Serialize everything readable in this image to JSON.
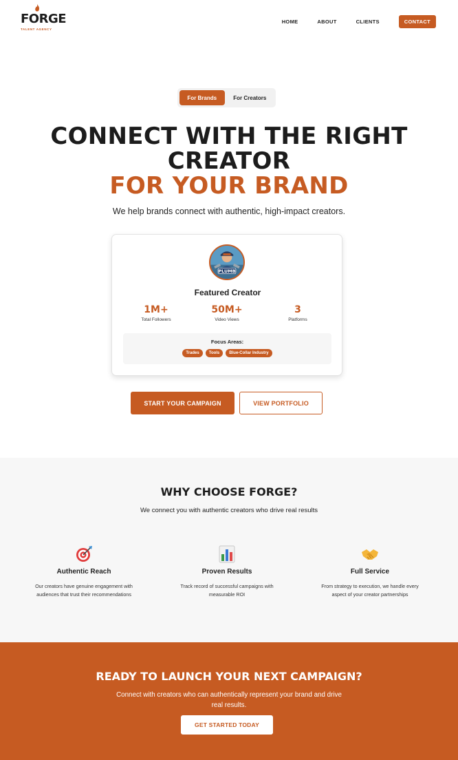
{
  "brand": {
    "name": "FORGE",
    "tagline": "TALENT AGENCY",
    "accent_color": "#c65b22"
  },
  "nav": {
    "items": [
      "HOME",
      "ABOUT",
      "CLIENTS"
    ],
    "contact_label": "CONTACT"
  },
  "toggle": {
    "active_label": "For Brands",
    "inactive_label": "For Creators"
  },
  "hero": {
    "line1": "CONNECT WITH THE RIGHT",
    "line2": "CREATOR",
    "line3": "FOR YOUR BRAND",
    "subtitle": "We help brands connect with authentic, high-impact creators."
  },
  "featured_card": {
    "avatar_icon": "plumber-mascot-avatar",
    "avatar_text": "PLUMB",
    "title": "Featured Creator",
    "stats": [
      {
        "value": "1M+",
        "label": "Total Followers"
      },
      {
        "value": "50M+",
        "label": "Video Views"
      },
      {
        "value": "3",
        "label": "Platforms"
      }
    ],
    "focus_title": "Focus Areas:",
    "focus_tags": [
      "Trades",
      "Tools",
      "Blue-Collar Industry"
    ]
  },
  "cta": {
    "primary_label": "START YOUR CAMPAIGN",
    "secondary_label": "VIEW PORTFOLIO"
  },
  "why": {
    "title": "WHY CHOOSE FORGE?",
    "subtitle": "We connect you with authentic creators who drive real results",
    "features": [
      {
        "icon": "target-icon",
        "title": "Authentic Reach",
        "desc": "Our creators have genuine engagement with audiences that trust their recommendations"
      },
      {
        "icon": "bar-chart-icon",
        "title": "Proven Results",
        "desc": "Track record of successful campaigns with measurable ROI"
      },
      {
        "icon": "handshake-icon",
        "title": "Full Service",
        "desc": "From strategy to execution, we handle every aspect of your creator partnerships"
      }
    ]
  },
  "launch": {
    "title": "READY TO LAUNCH YOUR NEXT CAMPAIGN?",
    "subtitle": "Connect with creators who can authentically represent your brand and drive real results.",
    "button_label": "GET STARTED TODAY"
  }
}
